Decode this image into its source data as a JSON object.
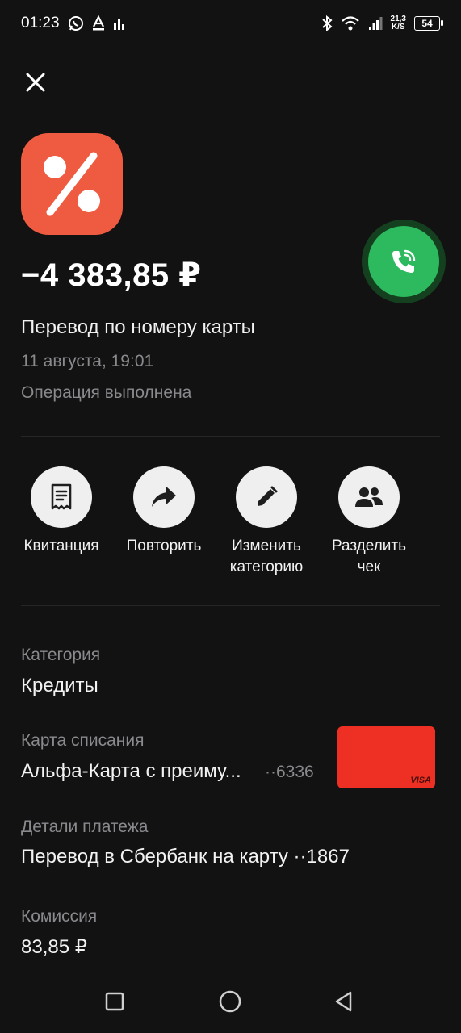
{
  "status_bar": {
    "time": "01:23",
    "notification_icons": [
      "whatsapp-icon",
      "alfa-icon",
      "chart-icon"
    ],
    "speed_value": "21,3",
    "speed_unit": "K/S",
    "battery": "54"
  },
  "header": {
    "close_icon": "close-icon"
  },
  "transaction": {
    "logo_icon": "percent-icon",
    "logo_color": "#ef5b40",
    "amount": "−4 383,85 ₽",
    "title": "Перевод по номеру карты",
    "date": "11 августа, 19:01",
    "status": "Операция выполнена",
    "call_icon": "phone-call-icon",
    "call_color": "#2dba5e"
  },
  "actions": [
    {
      "icon": "receipt-icon",
      "label_line1": "Квитанция",
      "label_line2": ""
    },
    {
      "icon": "share-arrow-icon",
      "label_line1": "Повторить",
      "label_line2": ""
    },
    {
      "icon": "pencil-icon",
      "label_line1": "Изменить",
      "label_line2": "категорию"
    },
    {
      "icon": "people-icon",
      "label_line1": "Разделить",
      "label_line2": "чек"
    }
  ],
  "details": {
    "category_label": "Категория",
    "category_value": "Кредиты",
    "card_label": "Карта списания",
    "card_value": "Альфа-Карта с преиму...",
    "card_mask": "··6336",
    "card_brand": "VISA",
    "card_color": "#ee3024",
    "payment_label": "Детали платежа",
    "payment_value": "Перевод в Сбербанк на карту ··1867",
    "fee_label": "Комиссия",
    "fee_value": "83,85 ₽"
  },
  "nav": [
    "recent-apps-icon",
    "home-icon",
    "back-icon"
  ]
}
